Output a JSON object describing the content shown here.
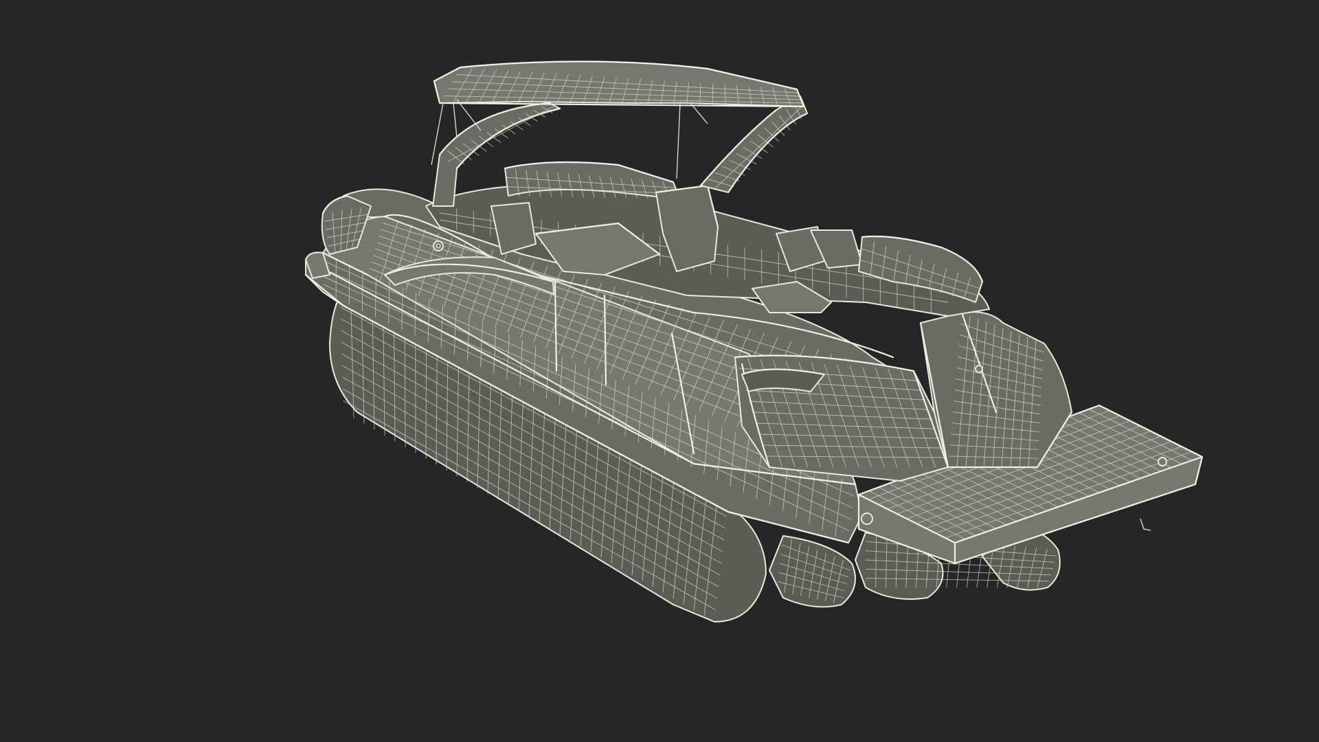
{
  "scene": {
    "subject": "pontoon-boat-wireframe",
    "background_color": "#262626",
    "mesh_fill_color": "#6b6b63",
    "wire_color": "#e9e9dc"
  }
}
